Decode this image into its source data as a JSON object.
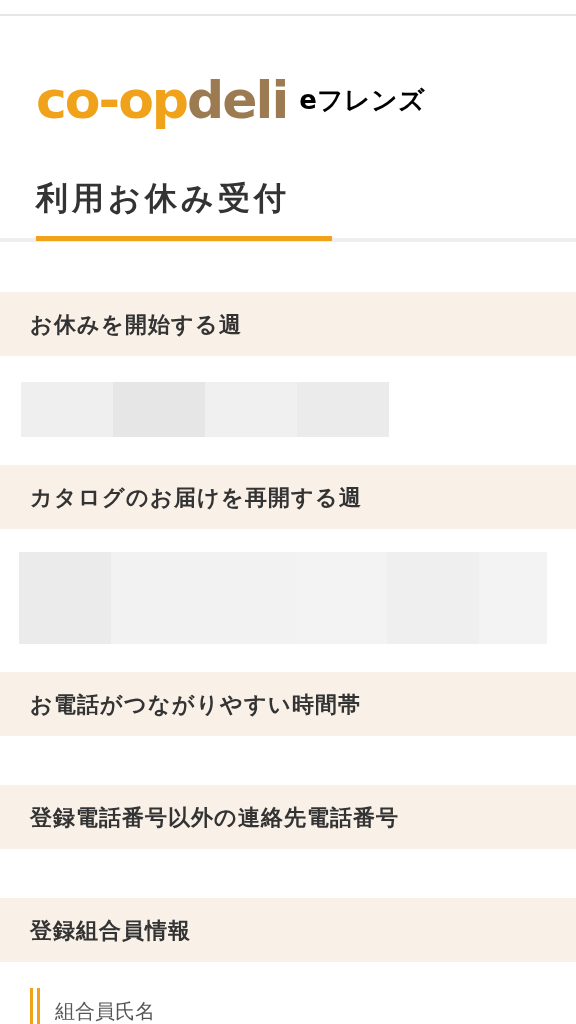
{
  "logo": {
    "part_1": "co-op",
    "part_2": "deli",
    "service": "eフレンズ"
  },
  "page_title": "利用お休み受付",
  "sections": [
    {
      "heading": "お休みを開始する週",
      "body": {
        "kind": "mosaic_short"
      }
    },
    {
      "heading": "カタログのお届けを再開する週",
      "body": {
        "kind": "mosaic_tall"
      }
    },
    {
      "heading": "お電話がつながりやすい時間帯",
      "body": {
        "kind": "empty"
      }
    },
    {
      "heading": "登録電話番号以外の連絡先電話番号",
      "body": {
        "kind": "empty"
      }
    },
    {
      "heading": "登録組合員情報",
      "body": {
        "kind": "field_label",
        "label": "組合員氏名"
      }
    }
  ]
}
